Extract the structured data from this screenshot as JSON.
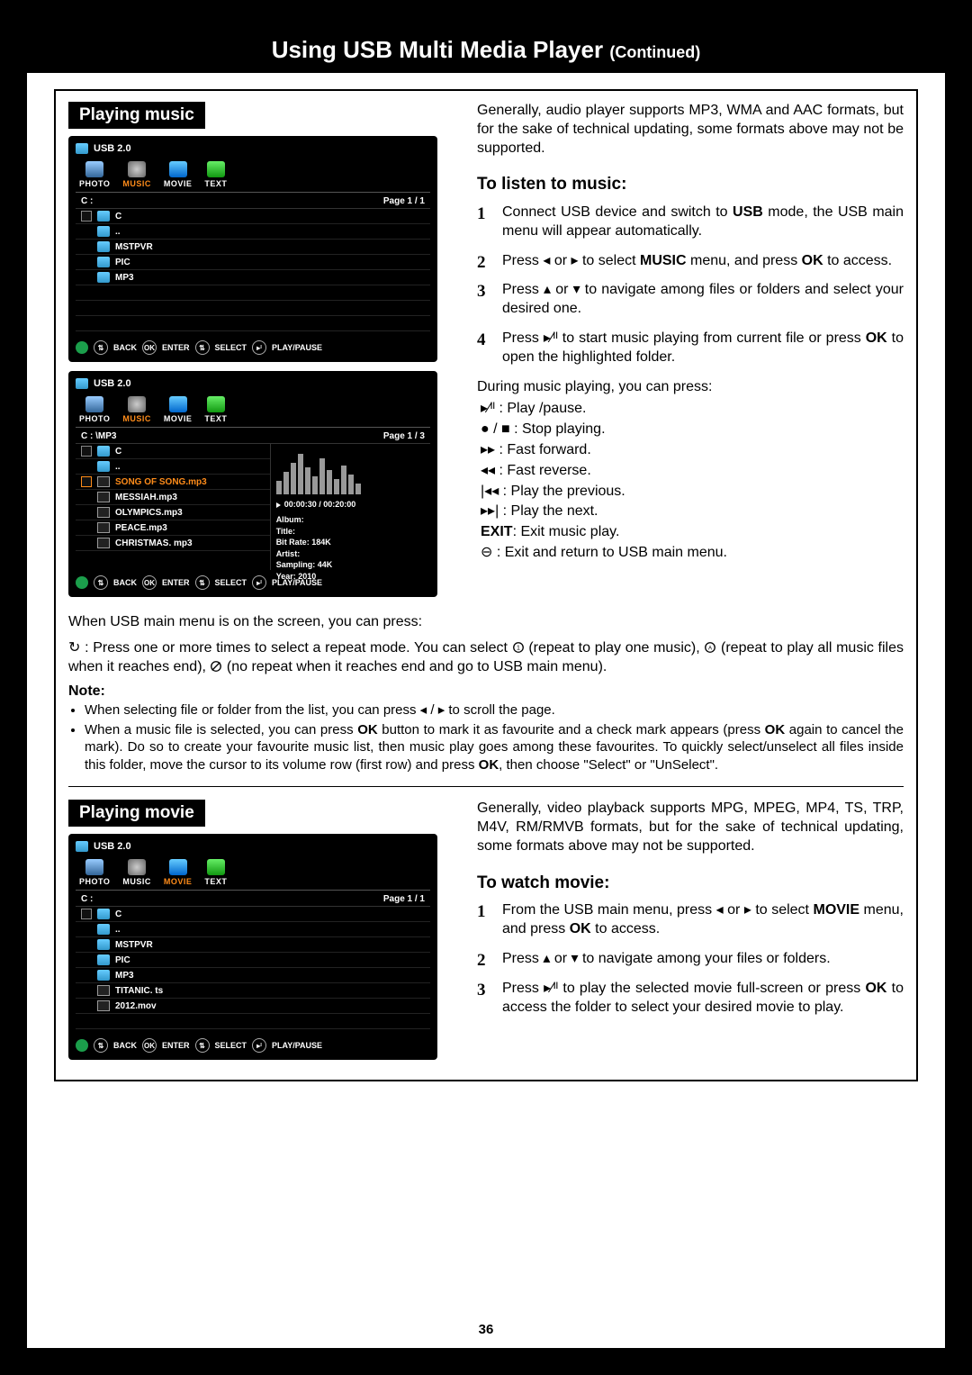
{
  "page_title": "Using USB Multi Media Player",
  "page_title_sub": "(Continued)",
  "page_number": "36",
  "section1": {
    "label": "Playing music",
    "osd1": {
      "usb_label": "USB 2.0",
      "tabs": {
        "photo": "PHOTO",
        "music": "MUSIC",
        "movie": "MOVIE",
        "text": "TEXT"
      },
      "selected_tab": "MUSIC",
      "path": "C :",
      "page": "Page 1 / 1",
      "rows": [
        "C",
        "..",
        "MSTPVR",
        "PIC",
        "MP3"
      ],
      "hints": {
        "back": "BACK",
        "ok": "OK",
        "enter": "ENTER",
        "select": "SELECT",
        "play": "PLAY/PAUSE"
      }
    },
    "osd2": {
      "usb_label": "USB 2.0",
      "tabs": {
        "photo": "PHOTO",
        "music": "MUSIC",
        "movie": "MOVIE",
        "text": "TEXT"
      },
      "selected_tab": "MUSIC",
      "path": "C : \\MP3",
      "page": "Page 1 / 3",
      "rows": [
        "C",
        "..",
        "SONG OF SONG.mp3",
        "MESSIAH.mp3",
        "OLYMPICS.mp3",
        "PEACE.mp3",
        "CHRISTMAS. mp3"
      ],
      "selected_row": "SONG OF SONG.mp3",
      "time": "00:00:30  /  00:20:00",
      "meta": [
        "Album:",
        "Title:",
        "Bit Rate:  184K",
        "Artist:",
        "Sampling:  44K",
        "Year:  2010"
      ],
      "hints": {
        "back": "BACK",
        "ok": "OK",
        "enter": "ENTER",
        "select": "SELECT",
        "play": "PLAY/PAUSE"
      }
    },
    "intro": "Generally, audio player supports MP3, WMA and AAC formats, but for the sake of technical updating, some formats above may not be supported.",
    "sub_heading": "To listen to music:",
    "steps": [
      {
        "pre": "Connect USB device and switch to ",
        "b1": "USB",
        "post": " mode, the USB main menu will appear automatically."
      },
      {
        "pre": "Press ◂ or ▸ to select ",
        "b1": "MUSIC",
        "mid": " menu, and press ",
        "b2": "OK",
        "post": " to access."
      },
      {
        "text": "Press ▴ or ▾ to navigate among files or folders and select your desired one."
      },
      {
        "pre": "Press ▸⁄ᴵᴵ to start music playing from current file or press ",
        "b1": "OK",
        "post": " to open the highlighted folder."
      }
    ],
    "during": "During music playing, you can press:",
    "controls": [
      "▸⁄ᴵᴵ :  Play /pause.",
      "● / ■ :  Stop playing.",
      "▸▸ :  Fast forward.",
      "◂◂ :  Fast reverse.",
      "|◂◂ :  Play the previous.",
      "▸▸| :  Play the next."
    ],
    "exit_line": {
      "b": "EXIT",
      "post": ": Exit music play."
    },
    "return_line": "⊖ : Exit and return to USB main menu.",
    "bottom_p1": "When USB main menu is on the screen, you can press:",
    "bottom_p2_a": "↻ : Press one or more times to select a repeat mode. You can select ",
    "bottom_p2_b": " (repeat to play one music), ",
    "bottom_p2_c": " (repeat to play all music files when it reaches end), ",
    "bottom_p2_d": " (no repeat when it reaches end and go to USB main menu).",
    "note_label": "Note:",
    "notes": [
      "When selecting file or folder from the list, you can  press ◂ / ▸ to scroll the page.",
      "When a music file is selected, you can press OK button to mark it as favourite and a check mark appears (press OK again to cancel the mark). Do so to create your favourite music list, then music play goes among these favourites. To quickly select/unselect all files inside this folder, move the cursor to its volume row (first row) and press OK, then choose \"Select\" or \"UnSelect\"."
    ]
  },
  "section2": {
    "label": "Playing movie",
    "osd": {
      "usb_label": "USB 2.0",
      "tabs": {
        "photo": "PHOTO",
        "music": "MUSIC",
        "movie": "MOVIE",
        "text": "TEXT"
      },
      "selected_tab": "MOVIE",
      "path": "C :",
      "page": "Page 1 / 1",
      "rows": [
        "C",
        "..",
        "MSTPVR",
        "PIC",
        "MP3",
        "TITANIC. ts",
        "2012.mov"
      ],
      "hints": {
        "back": "BACK",
        "ok": "OK",
        "enter": "ENTER",
        "select": "SELECT",
        "play": "PLAY/PAUSE"
      }
    },
    "intro": "Generally, video playback supports MPG, MPEG, MP4, TS, TRP, M4V, RM/RMVB formats, but for the sake of technical updating, some formats above may not be supported.",
    "sub_heading": "To watch movie:",
    "steps": [
      {
        "pre": "From the USB main menu, press ◂ or ▸ to select ",
        "b1": "MOVIE",
        "mid": " menu, and press ",
        "b2": "OK",
        "post": " to access."
      },
      {
        "text": "Press ▴ or ▾ to navigate among your files or folders."
      },
      {
        "pre": "Press ▸⁄ᴵᴵ to play the selected movie full-screen or press ",
        "b1": "OK",
        "post": " to access the folder to select your desired movie to play."
      }
    ]
  }
}
